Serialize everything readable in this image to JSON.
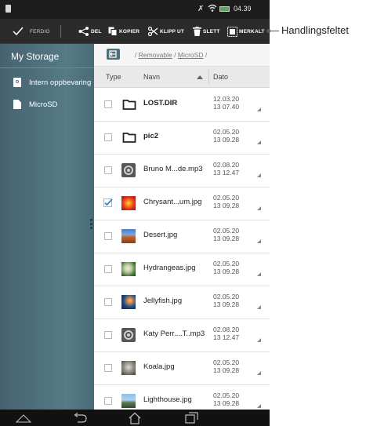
{
  "status": {
    "time": "04.39"
  },
  "actionbar": {
    "done_label": "FERDIG",
    "share_label": "DEL",
    "copy_label": "KOPIER",
    "cut_label": "KLIPP UT",
    "delete_label": "SLETT",
    "more_label": "MERKALT"
  },
  "callout": {
    "label": "Handlingsfeltet"
  },
  "sidebar": {
    "title": "My Storage",
    "items": [
      {
        "label": "Intern oppbevaring",
        "icon": "phone-storage-icon"
      },
      {
        "label": "MicroSD",
        "icon": "sd-card-icon"
      }
    ]
  },
  "breadcrumb": {
    "sep1": "/",
    "crumb1": "Removable",
    "sep2": "/",
    "crumb2": "MicroSD",
    "sep3": "/"
  },
  "columns": {
    "type": "Type",
    "name": "Navn",
    "date": "Dato"
  },
  "files": [
    {
      "name": "LOST.DIR",
      "date": "12.03.20",
      "time": "13 07.40",
      "kind": "folder",
      "checked": false
    },
    {
      "name": "pic2",
      "date": "02.05.20",
      "time": "13 09.28",
      "kind": "folder",
      "checked": false
    },
    {
      "name": "Bruno M...de.mp3",
      "date": "02.08.20",
      "time": "13 12.47",
      "kind": "audio",
      "checked": false
    },
    {
      "name": "Chrysant...um.jpg",
      "date": "02.05.20",
      "time": "13 09.28",
      "kind": "image-chrysanthemum",
      "checked": true
    },
    {
      "name": "Desert.jpg",
      "date": "02.05.20",
      "time": "13 09.28",
      "kind": "image-desert",
      "checked": false
    },
    {
      "name": "Hydrangeas.jpg",
      "date": "02.05.20",
      "time": "13 09.28",
      "kind": "image-hydrangeas",
      "checked": false
    },
    {
      "name": "Jellyfish.jpg",
      "date": "02.05.20",
      "time": "13 09.28",
      "kind": "image-jellyfish",
      "checked": false
    },
    {
      "name": "Katy Perr....T..mp3",
      "date": "02.08.20",
      "time": "13 12.47",
      "kind": "audio",
      "checked": false
    },
    {
      "name": "Koala.jpg",
      "date": "02.05.20",
      "time": "13 09.28",
      "kind": "image-koala",
      "checked": false
    },
    {
      "name": "Lighthouse.jpg",
      "date": "02.05.20",
      "time": "13 09.28",
      "kind": "image-lighthouse",
      "checked": false
    }
  ],
  "colors": {
    "accent": "#2a8fd0",
    "sidebar": "#567a86",
    "checkbox_checked": "#2f86c9"
  }
}
